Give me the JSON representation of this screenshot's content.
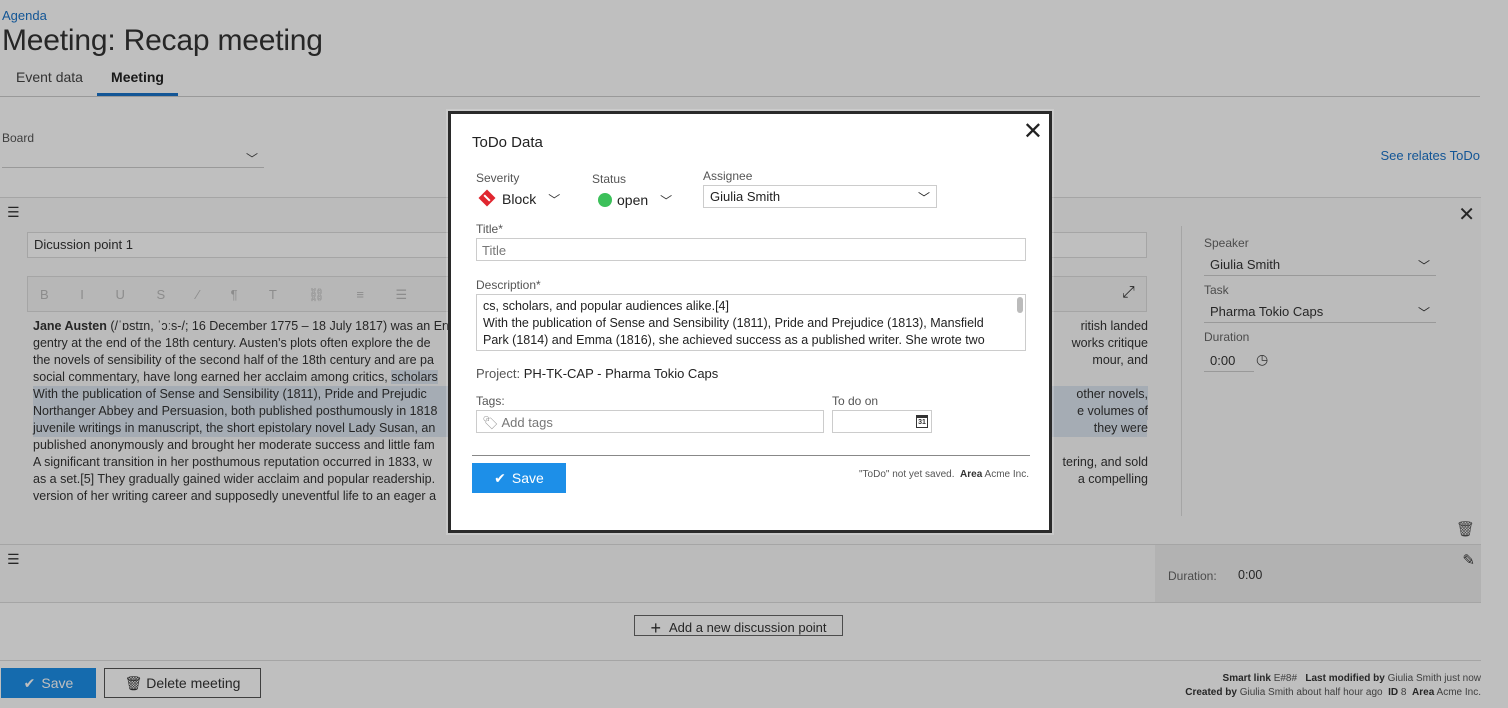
{
  "page": {
    "breadcrumb": "Agenda",
    "title": "Meeting: Recap meeting",
    "tabs": [
      {
        "label": "Event data"
      },
      {
        "label": "Meeting"
      }
    ],
    "active_tab": "Meeting"
  },
  "board": {
    "label": "Board",
    "value": ""
  },
  "see_relates": "See relates ToDo",
  "discussion_point_1": {
    "title": "Dicussion point 1",
    "toolbar_glyphs": "B I U S ⁄ ¶ T ⛓ ≡ ☰",
    "body": {
      "p1_bold": "Jane Austen",
      "p1a": " (/ˈɒstɪn, ˈɔːs-/; 16 December 1775 – 18 July 1817) was an En",
      "p1b": "ritish landed",
      "p2a": "gentry at the end of the 18th century. Austen's plots often explore the de",
      "p2b": "works critique",
      "p3a": "the novels of sensibility of the second half of the 18th century and are pa",
      "p3b": "mour, and",
      "p4a": "social commentary, have long earned her acclaim among critics, ",
      "p4hl": "scholars",
      "p5a": "With the publication of Sense and Sensibility (1811), Pride and Prejudic",
      "p5b": "other novels,",
      "p6a": "Northanger Abbey and Persuasion, both published posthumously in 1818",
      "p6b": "e volumes of",
      "p7a": "juvenile writings in manuscript, the short epistolary novel Lady Susan, an",
      "p7b": "they were",
      "p8a": "published anonymously and brought her moderate success and little fam",
      "p9a": "A significant transition in her posthumous reputation occurred in 1833, w",
      "p9b": "tering, and sold",
      "p10a": "as a set.[5] They gradually gained wider acclaim and popular readership.",
      "p10b": "a compelling",
      "p11a": "version of her writing career and supposedly uneventful life to an eager a"
    },
    "speaker": {
      "label": "Speaker",
      "value": "Giulia Smith"
    },
    "task": {
      "label": "Task",
      "value": "Pharma Tokio Caps"
    },
    "duration": {
      "label": "Duration",
      "value": "0:00"
    }
  },
  "discussion_point_2": {
    "duration_label": "Duration:",
    "duration_value": "0:00"
  },
  "add_discussion_point": "Add a new discussion point",
  "footer": {
    "save": "Save",
    "delete": "Delete meeting",
    "smart_link_label": "Smart link",
    "smart_link_value": "E#8#",
    "last_modified_label": "Last modified by",
    "last_modified_value": "Giulia Smith  just now",
    "created_label": "Created by",
    "created_value": "Giulia Smith  about half hour ago",
    "id_label": "ID",
    "id_value": "8",
    "area_label": "Area",
    "area_value": "Acme Inc."
  },
  "modal": {
    "title": "ToDo Data",
    "severity": {
      "label": "Severity",
      "value": "Block",
      "color": "#e0262f"
    },
    "status": {
      "label": "Status",
      "value": "open",
      "color": "#3cc05a"
    },
    "assignee": {
      "label": "Assignee",
      "value": "Giulia Smith"
    },
    "title_field": {
      "label": "Title*",
      "placeholder": "Title"
    },
    "description": {
      "label": "Description*",
      "line1": "cs, scholars, and popular audiences alike.[4]",
      "line2": "With the publication of Sense and Sensibility (1811), Pride and Prejudice (1813), Mansfield",
      "line3": "Park (1814) and Emma (1816), she achieved success as a published writer. She wrote two"
    },
    "project_label": "Project:",
    "project_value": "PH-TK-CAP - Pharma Tokio Caps",
    "tags": {
      "label": "Tags:",
      "placeholder": "Add tags"
    },
    "todo_on": {
      "label": "To do on",
      "value": ""
    },
    "save": "Save",
    "not_saved": "\"ToDo\" not yet saved.",
    "area_label": "Area",
    "area_value": "Acme Inc."
  }
}
